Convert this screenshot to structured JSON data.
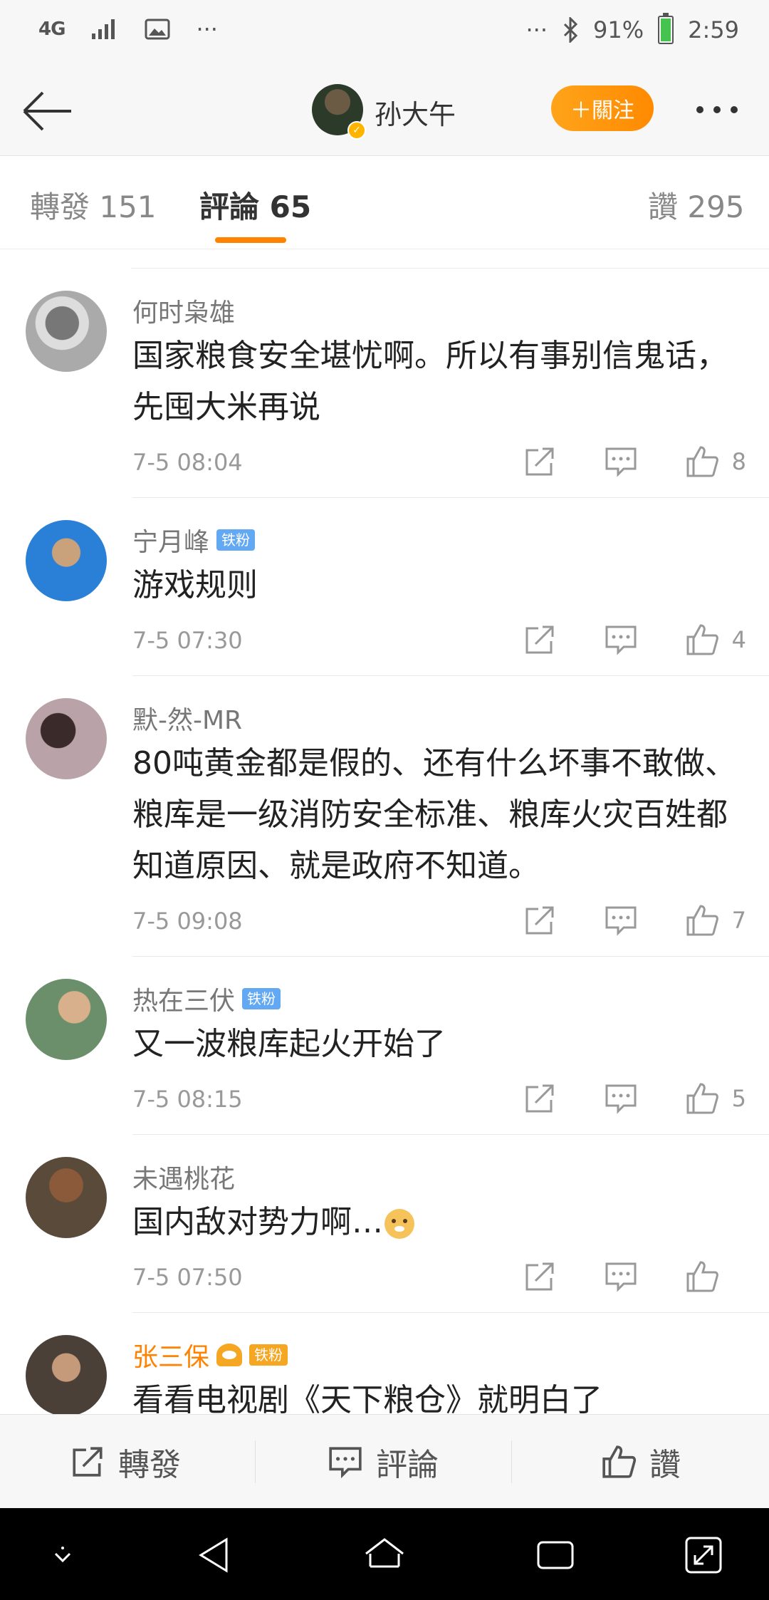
{
  "status_bar": {
    "network": "4G",
    "more_dots": "···",
    "right_dots": "···",
    "battery": "91%",
    "battery_level": 0.91,
    "time": "2:59"
  },
  "header": {
    "back_icon": "back-arrow-icon",
    "user_name": "孙大午",
    "follow_label": "＋關注",
    "more_icon": "more-dots-icon"
  },
  "tabs": {
    "repost": "轉發 151",
    "comments": "評論 65",
    "likes": "讚 295"
  },
  "comments": [
    {
      "name": "何时枭雄",
      "badge": "",
      "text": "国家粮食安全堪忧啊。所以有事别信鬼话，先囤大米再说",
      "time": "7-5 08:04",
      "likes": "8"
    },
    {
      "name": "宁月峰",
      "badge": "铁粉",
      "text": "游戏规则",
      "time": "7-5 07:30",
      "likes": "4"
    },
    {
      "name": "默-然-MR",
      "badge": "",
      "text": "80吨黄金都是假的、还有什么坏事不敢做、粮库是一级消防安全标准、粮库火灾百姓都知道原因、就是政府不知道。",
      "time": "7-5 09:08",
      "likes": "7"
    },
    {
      "name": "热在三伏",
      "badge": "铁粉",
      "text": "又一波粮库起火开始了",
      "time": "7-5 08:15",
      "likes": "5"
    },
    {
      "name": "未遇桃花",
      "badge": "",
      "text": "国内敌对势力啊…",
      "time": "7-5 07:50",
      "likes": ""
    },
    {
      "name": "张三保",
      "badge": "铁粉",
      "text": "看看电视剧《天下粮仓》就明白了",
      "time": "",
      "likes": ""
    }
  ],
  "bottom_bar": {
    "repost": "轉發",
    "comment": "評論",
    "like": "讚"
  },
  "colors": {
    "accent": "#ff8200",
    "fan_badge": "#62a8f2",
    "text": "#222222",
    "muted": "#999999"
  }
}
